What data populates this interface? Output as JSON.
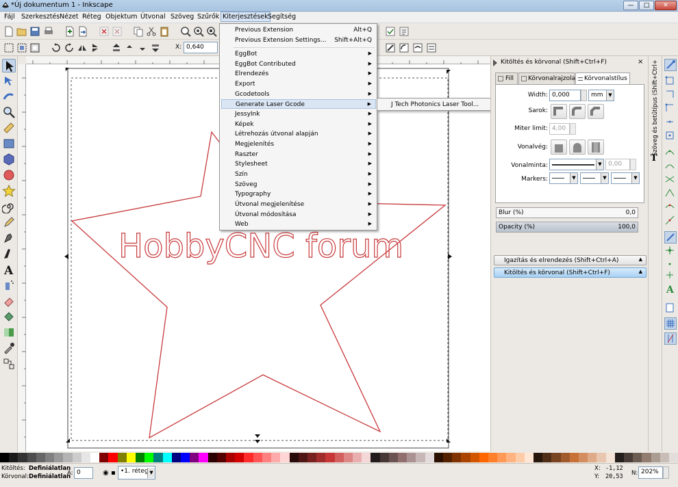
{
  "window": {
    "title": "*Új dokumentum 1 - Inkscape",
    "minimize_glyph": "—",
    "maximize_glyph": "□",
    "close_glyph": "✕"
  },
  "menubar": {
    "items": [
      "Fájl",
      "Szerkesztés",
      "Nézet",
      "Réteg",
      "Objektum",
      "Útvonal",
      "Szöveg",
      "Szűrők",
      "Kiterjesztések",
      "Segítség"
    ]
  },
  "toolbar": {
    "x_label": "X:",
    "x_value": "0,640"
  },
  "canvas": {
    "text": "HobbyCNC forum",
    "stroke_color": "#c8393b"
  },
  "extensions_menu": {
    "items": [
      {
        "label": "Previous Extension",
        "shortcut": "Alt+Q"
      },
      {
        "label": "Previous Extension Settings...",
        "shortcut": "Shift+Alt+Q"
      },
      {
        "label": "EggBot",
        "arrow": "▶"
      },
      {
        "label": "EggBot Contributed",
        "arrow": "▶"
      },
      {
        "label": "Elrendezés",
        "arrow": "▶"
      },
      {
        "label": "Export",
        "arrow": "▶"
      },
      {
        "label": "Gcodetools",
        "arrow": "▶"
      },
      {
        "label": "Generate Laser Gcode",
        "arrow": "▶"
      },
      {
        "label": "JessyInk",
        "arrow": "▶"
      },
      {
        "label": "Képek",
        "arrow": "▶"
      },
      {
        "label": "Létrehozás útvonal alapján",
        "arrow": "▶"
      },
      {
        "label": "Megjelenítés",
        "arrow": "▶"
      },
      {
        "label": "Raszter",
        "arrow": "▶"
      },
      {
        "label": "Stylesheet",
        "arrow": "▶"
      },
      {
        "label": "Szín",
        "arrow": "▶"
      },
      {
        "label": "Szöveg",
        "arrow": "▶"
      },
      {
        "label": "Typography",
        "arrow": "▶"
      },
      {
        "label": "Útvonal megjelenítése",
        "arrow": "▶"
      },
      {
        "label": "Útvonal módosítása",
        "arrow": "▶"
      },
      {
        "label": "Web",
        "arrow": "▶"
      }
    ]
  },
  "submenu": {
    "item": "J Tech Photonics Laser Tool..."
  },
  "dock": {
    "title": "Kitöltés és körvonal (Shift+Ctrl+F)",
    "tabs": [
      "Fill",
      "Körvonalrajzolat",
      "Körvonalstílus"
    ],
    "width_label": "Width:",
    "width_value": "0,000",
    "unit": "mm",
    "sarok_label": "Sarok:",
    "miter_label": "Miter limit:",
    "miter_value": "4,00",
    "vonalveg_label": "Vonalvég:",
    "vonalminta_label": "Vonalminta:",
    "vonalminta_value": "0,00",
    "markers_label": "Markers:",
    "blur_label": "Blur (%)",
    "blur_value": "0,0",
    "opacity_label": "Opacity (%)",
    "opacity_value": "100,0",
    "dock_items": [
      "Igazítás és elrendezés (Shift+Ctrl+A)",
      "Kitöltés és körvonal (Shift+Ctrl+F)"
    ],
    "side_tab": "Szöveg és betűtípus (Shift+Ctrl+T)"
  },
  "status": {
    "fill_label": "Kitöltés:",
    "fill_value": "Definiálatlan",
    "stroke_label": "Körvonal:",
    "stroke_value": "Definiálatlan",
    "a_label": "A:",
    "a_value": "0",
    "layer": "•1. réteg",
    "x_label": "X:",
    "x_value": "-1,12",
    "y_label": "Y:",
    "y_value": "20,53",
    "zoom_label": "N:",
    "zoom_value": "202%"
  },
  "colors": {
    "accent": "#c8393b",
    "menu_highlight": "#dbe6f4",
    "dock_active": "#a9d1f2"
  }
}
